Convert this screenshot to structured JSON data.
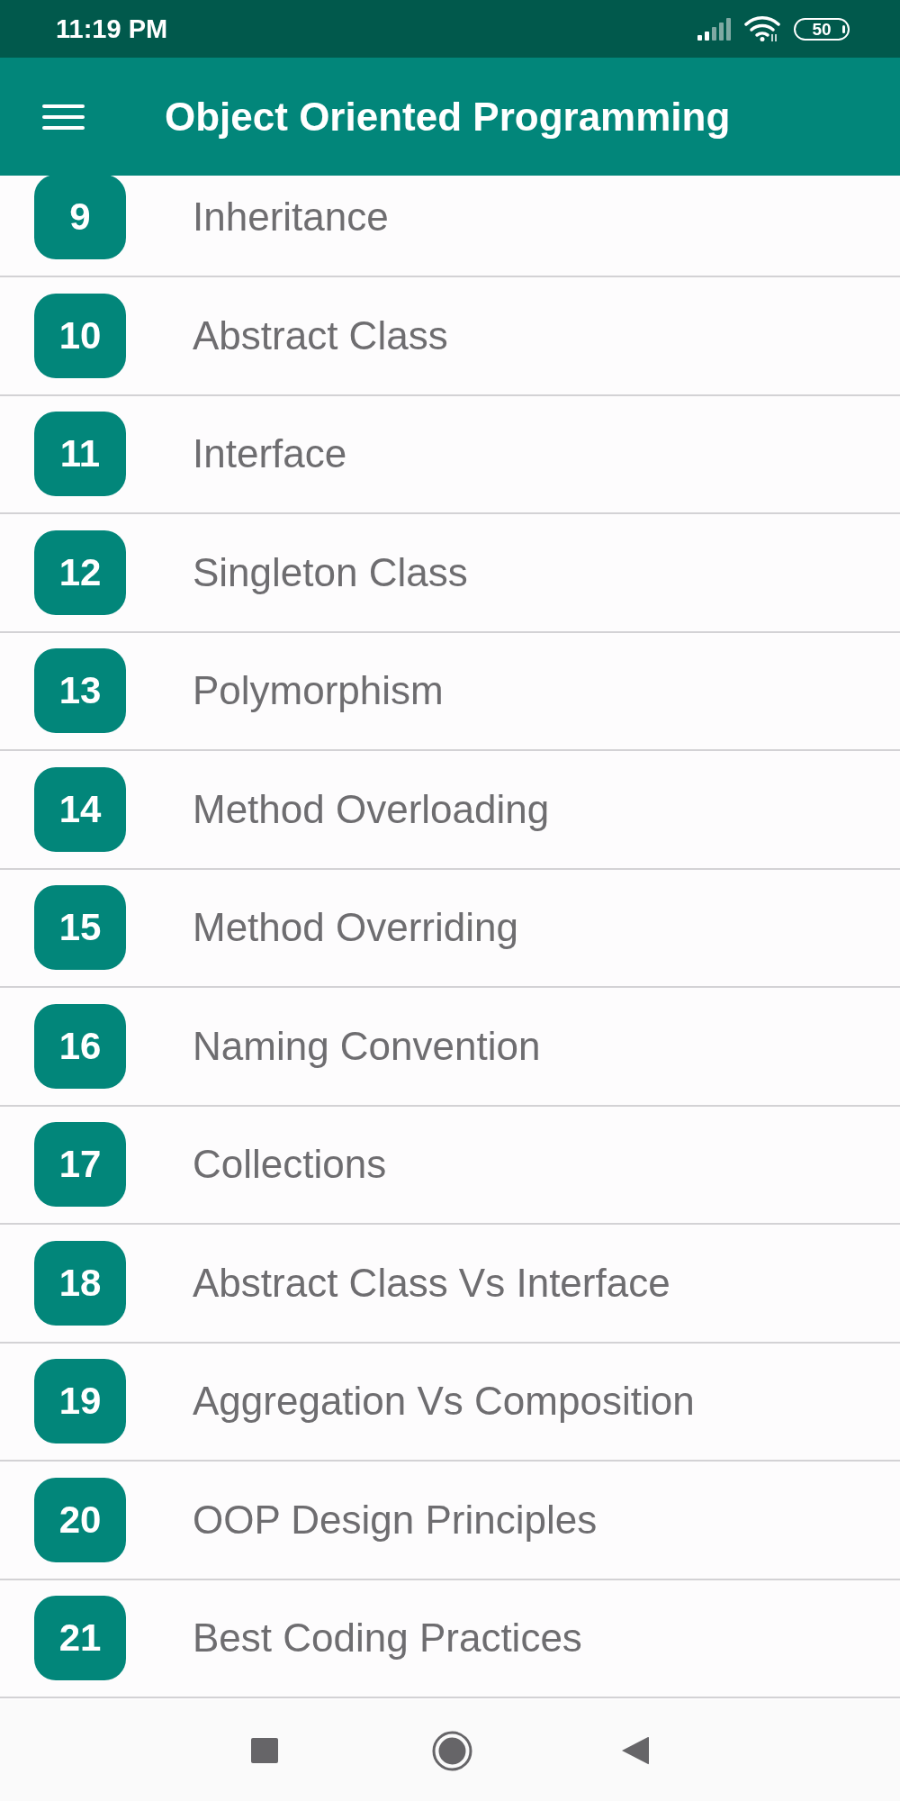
{
  "status_bar": {
    "time": "11:19 PM",
    "battery": "50"
  },
  "app_bar": {
    "title": "Object Oriented Programming"
  },
  "topics": [
    {
      "number": "9",
      "title": "Inheritance"
    },
    {
      "number": "10",
      "title": "Abstract Class"
    },
    {
      "number": "11",
      "title": "Interface"
    },
    {
      "number": "12",
      "title": "Singleton Class"
    },
    {
      "number": "13",
      "title": "Polymorphism"
    },
    {
      "number": "14",
      "title": "Method Overloading"
    },
    {
      "number": "15",
      "title": "Method Overriding"
    },
    {
      "number": "16",
      "title": "Naming Convention"
    },
    {
      "number": "17",
      "title": "Collections"
    },
    {
      "number": "18",
      "title": "Abstract Class Vs Interface"
    },
    {
      "number": "19",
      "title": "Aggregation Vs Composition"
    },
    {
      "number": "20",
      "title": "OOP Design Principles"
    },
    {
      "number": "21",
      "title": "Best Coding Practices"
    }
  ]
}
